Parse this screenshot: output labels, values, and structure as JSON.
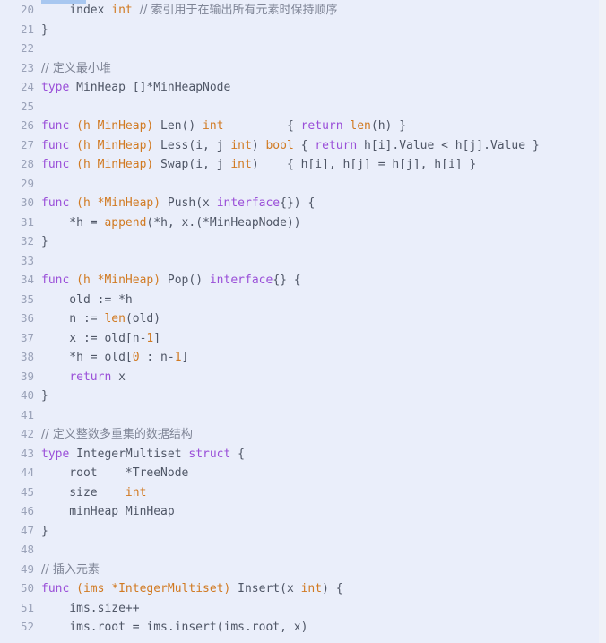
{
  "editor": {
    "language": "Go",
    "first_visible_line": 20,
    "last_visible_line": 52,
    "background_color": "#eaeefa",
    "gutter_color": "#9aa2b8",
    "selection_color": "#a8c7f0",
    "colors": {
      "keyword": "#9a4fd8",
      "type": "#d17a22",
      "number": "#d17a22",
      "builtin": "#d17a22",
      "comment": "#7f8596",
      "plain": "#4f5666"
    }
  },
  "lines": [
    {
      "number": "20",
      "tokens": [
        {
          "t": "plain",
          "s": "    index "
        },
        {
          "t": "type",
          "s": "int"
        },
        {
          "t": "plain",
          "s": " "
        },
        {
          "t": "comment",
          "s": "// 索引用于在输出所有元素时保持顺序"
        }
      ]
    },
    {
      "number": "21",
      "tokens": [
        {
          "t": "punct",
          "s": "}"
        }
      ]
    },
    {
      "number": "22",
      "tokens": [
        {
          "t": "plain",
          "s": ""
        }
      ]
    },
    {
      "number": "23",
      "tokens": [
        {
          "t": "comment",
          "s": "// 定义最小堆"
        }
      ]
    },
    {
      "number": "24",
      "tokens": [
        {
          "t": "kw",
          "s": "type"
        },
        {
          "t": "plain",
          "s": " MinHeap []*MinHeapNode"
        }
      ]
    },
    {
      "number": "25",
      "tokens": [
        {
          "t": "plain",
          "s": ""
        }
      ]
    },
    {
      "number": "26",
      "tokens": [
        {
          "t": "kw",
          "s": "func"
        },
        {
          "t": "plain",
          "s": " "
        },
        {
          "t": "type",
          "s": "(h MinHeap)"
        },
        {
          "t": "plain",
          "s": " Len() "
        },
        {
          "t": "type",
          "s": "int"
        },
        {
          "t": "plain",
          "s": "         { "
        },
        {
          "t": "kw",
          "s": "return"
        },
        {
          "t": "plain",
          "s": " "
        },
        {
          "t": "builtin",
          "s": "len"
        },
        {
          "t": "plain",
          "s": "(h) }"
        }
      ]
    },
    {
      "number": "27",
      "tokens": [
        {
          "t": "kw",
          "s": "func"
        },
        {
          "t": "plain",
          "s": " "
        },
        {
          "t": "type",
          "s": "(h MinHeap)"
        },
        {
          "t": "plain",
          "s": " Less(i, j "
        },
        {
          "t": "type",
          "s": "int"
        },
        {
          "t": "plain",
          "s": ") "
        },
        {
          "t": "type",
          "s": "bool"
        },
        {
          "t": "plain",
          "s": " { "
        },
        {
          "t": "kw",
          "s": "return"
        },
        {
          "t": "plain",
          "s": " h[i].Value < h[j].Value }"
        }
      ]
    },
    {
      "number": "28",
      "tokens": [
        {
          "t": "kw",
          "s": "func"
        },
        {
          "t": "plain",
          "s": " "
        },
        {
          "t": "type",
          "s": "(h MinHeap)"
        },
        {
          "t": "plain",
          "s": " Swap(i, j "
        },
        {
          "t": "type",
          "s": "int"
        },
        {
          "t": "plain",
          "s": ")    { h[i], h[j] = h[j], h[i] }"
        }
      ]
    },
    {
      "number": "29",
      "tokens": [
        {
          "t": "plain",
          "s": ""
        }
      ]
    },
    {
      "number": "30",
      "tokens": [
        {
          "t": "kw",
          "s": "func"
        },
        {
          "t": "plain",
          "s": " "
        },
        {
          "t": "type",
          "s": "(h *MinHeap)"
        },
        {
          "t": "plain",
          "s": " Push(x "
        },
        {
          "t": "kw",
          "s": "interface"
        },
        {
          "t": "plain",
          "s": "{}) {"
        }
      ]
    },
    {
      "number": "31",
      "tokens": [
        {
          "t": "plain",
          "s": "    *h = "
        },
        {
          "t": "builtin",
          "s": "append"
        },
        {
          "t": "plain",
          "s": "(*h, x.(*MinHeapNode))"
        }
      ]
    },
    {
      "number": "32",
      "tokens": [
        {
          "t": "punct",
          "s": "}"
        }
      ]
    },
    {
      "number": "33",
      "tokens": [
        {
          "t": "plain",
          "s": ""
        }
      ]
    },
    {
      "number": "34",
      "tokens": [
        {
          "t": "kw",
          "s": "func"
        },
        {
          "t": "plain",
          "s": " "
        },
        {
          "t": "type",
          "s": "(h *MinHeap)"
        },
        {
          "t": "plain",
          "s": " Pop() "
        },
        {
          "t": "kw",
          "s": "interface"
        },
        {
          "t": "plain",
          "s": "{} {"
        }
      ]
    },
    {
      "number": "35",
      "tokens": [
        {
          "t": "plain",
          "s": "    old := *h"
        }
      ]
    },
    {
      "number": "36",
      "tokens": [
        {
          "t": "plain",
          "s": "    n := "
        },
        {
          "t": "builtin",
          "s": "len"
        },
        {
          "t": "plain",
          "s": "(old)"
        }
      ]
    },
    {
      "number": "37",
      "tokens": [
        {
          "t": "plain",
          "s": "    x := old[n-"
        },
        {
          "t": "num",
          "s": "1"
        },
        {
          "t": "plain",
          "s": "]"
        }
      ]
    },
    {
      "number": "38",
      "tokens": [
        {
          "t": "plain",
          "s": "    *h = old["
        },
        {
          "t": "num",
          "s": "0"
        },
        {
          "t": "plain",
          "s": " : n-"
        },
        {
          "t": "num",
          "s": "1"
        },
        {
          "t": "plain",
          "s": "]"
        }
      ]
    },
    {
      "number": "39",
      "tokens": [
        {
          "t": "plain",
          "s": "    "
        },
        {
          "t": "kw",
          "s": "return"
        },
        {
          "t": "plain",
          "s": " x"
        }
      ]
    },
    {
      "number": "40",
      "tokens": [
        {
          "t": "punct",
          "s": "}"
        }
      ]
    },
    {
      "number": "41",
      "tokens": [
        {
          "t": "plain",
          "s": ""
        }
      ]
    },
    {
      "number": "42",
      "tokens": [
        {
          "t": "comment",
          "s": "// 定义整数多重集的数据结构"
        }
      ]
    },
    {
      "number": "43",
      "tokens": [
        {
          "t": "kw",
          "s": "type"
        },
        {
          "t": "plain",
          "s": " IntegerMultiset "
        },
        {
          "t": "kw",
          "s": "struct"
        },
        {
          "t": "plain",
          "s": " {"
        }
      ]
    },
    {
      "number": "44",
      "tokens": [
        {
          "t": "plain",
          "s": "    root    *TreeNode"
        }
      ]
    },
    {
      "number": "45",
      "tokens": [
        {
          "t": "plain",
          "s": "    size    "
        },
        {
          "t": "type",
          "s": "int"
        }
      ]
    },
    {
      "number": "46",
      "tokens": [
        {
          "t": "plain",
          "s": "    minHeap MinHeap"
        }
      ]
    },
    {
      "number": "47",
      "tokens": [
        {
          "t": "punct",
          "s": "}"
        }
      ]
    },
    {
      "number": "48",
      "tokens": [
        {
          "t": "plain",
          "s": ""
        }
      ]
    },
    {
      "number": "49",
      "tokens": [
        {
          "t": "comment",
          "s": "// 插入元素"
        }
      ]
    },
    {
      "number": "50",
      "tokens": [
        {
          "t": "kw",
          "s": "func"
        },
        {
          "t": "plain",
          "s": " "
        },
        {
          "t": "type",
          "s": "(ims *IntegerMultiset)"
        },
        {
          "t": "plain",
          "s": " Insert(x "
        },
        {
          "t": "type",
          "s": "int"
        },
        {
          "t": "plain",
          "s": ") {"
        }
      ]
    },
    {
      "number": "51",
      "tokens": [
        {
          "t": "plain",
          "s": "    ims.size++"
        }
      ]
    },
    {
      "number": "52",
      "tokens": [
        {
          "t": "plain",
          "s": "    ims.root = ims.insert(ims.root, x)"
        }
      ]
    }
  ]
}
